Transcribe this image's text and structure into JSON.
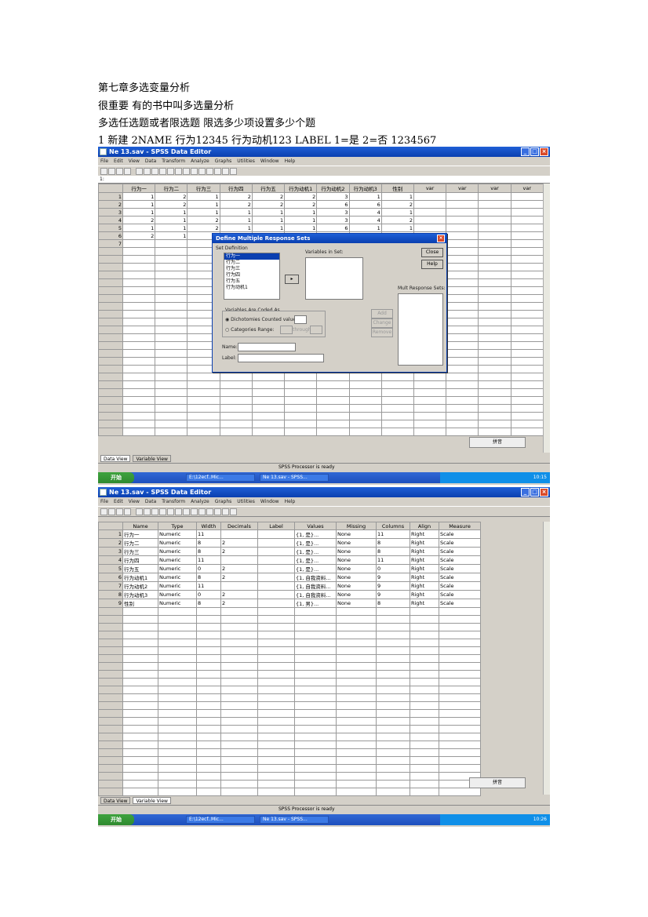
{
  "document": {
    "lines": [
      "第七章多选变量分析",
      "很重要  有的书中叫多选量分析",
      "多选任选题或者限选题  限选多少项设置多少个题",
      "1  新建  2NAME  行为12345  行为动机123 LABEL 1=是  2=否  1234567"
    ]
  },
  "window1": {
    "title": "Ne 13.sav - SPSS Data Editor",
    "menu": [
      "File",
      "Edit",
      "View",
      "Data",
      "Transform",
      "Analyze",
      "Graphs",
      "Utilities",
      "Window",
      "Help"
    ],
    "cell_ref": "1:",
    "columns": [
      "行为一",
      "行为二",
      "行为三",
      "行为四",
      "行为五",
      "行为动机1",
      "行为动机2",
      "行为动机3",
      "性别",
      "var",
      "var",
      "var",
      "var"
    ],
    "rows": [
      {
        "n": "1",
        "v": [
          "1",
          "2",
          "1",
          "2",
          "2",
          "2",
          "3",
          "1",
          "1"
        ]
      },
      {
        "n": "2",
        "v": [
          "1",
          "2",
          "1",
          "2",
          "2",
          "2",
          "6",
          "6",
          "2"
        ]
      },
      {
        "n": "3",
        "v": [
          "1",
          "1",
          "1",
          "1",
          "1",
          "1",
          "3",
          "4",
          "1"
        ]
      },
      {
        "n": "4",
        "v": [
          "2",
          "1",
          "2",
          "1",
          "1",
          "1",
          "3",
          "4",
          "2"
        ]
      },
      {
        "n": "5",
        "v": [
          "1",
          "1",
          "2",
          "1",
          "1",
          "1",
          "6",
          "1",
          "1"
        ]
      },
      {
        "n": "6",
        "v": [
          "2",
          "1",
          "1",
          "2",
          "2",
          "2",
          "5",
          "4",
          "2"
        ]
      },
      {
        "n": "7",
        "v": [
          "",
          "",
          "",
          "",
          "",
          "",
          "",
          "",
          ""
        ]
      }
    ],
    "tabs": [
      "Data View",
      "Variable View"
    ],
    "status": "SPSS Processor is ready",
    "taskbar": {
      "start": "开始",
      "items": [
        "E:\\12ecf..Mic...",
        "Ne 13.sav - SPSS..."
      ],
      "clock": "10:15"
    },
    "ime": "拼音"
  },
  "dialog": {
    "title": "Define Multiple Response Sets",
    "set_definition_label": "Set Definition",
    "variables": [
      "行为一",
      "行为二",
      "行为三",
      "行为四",
      "行为五",
      "行为动机1"
    ],
    "variables_in_set_label": "Variables in Set:",
    "buttons": {
      "close": "Close",
      "help": "Help",
      "add": "Add",
      "change": "Change",
      "remove": "Remove"
    },
    "mult_response_sets_label": "Mult Response Sets:",
    "coded_as_label": "Variables Are Coded As",
    "dichotomies_label": "Dichotomies  Counted value:",
    "categories_label": "Categories  Range:",
    "through_label": "through",
    "name_label": "Name:",
    "label_label": "Label:"
  },
  "window2": {
    "title": "Ne 13.sav - SPSS Data Editor",
    "columns": [
      "Name",
      "Type",
      "Width",
      "Decimals",
      "Label",
      "Values",
      "Missing",
      "Columns",
      "Align",
      "Measure"
    ],
    "rows": [
      {
        "n": "1",
        "v": [
          "行为一",
          "Numeric",
          "11",
          "",
          "",
          "{1, 是}...",
          "None",
          "11",
          "Right",
          "Scale"
        ]
      },
      {
        "n": "2",
        "v": [
          "行为二",
          "Numeric",
          "8",
          "2",
          "",
          "{1, 是}...",
          "None",
          "8",
          "Right",
          "Scale"
        ]
      },
      {
        "n": "3",
        "v": [
          "行为三",
          "Numeric",
          "8",
          "2",
          "",
          "{1, 是}...",
          "None",
          "8",
          "Right",
          "Scale"
        ]
      },
      {
        "n": "4",
        "v": [
          "行为四",
          "Numeric",
          "11",
          "",
          "",
          "{1, 是}...",
          "None",
          "11",
          "Right",
          "Scale"
        ]
      },
      {
        "n": "5",
        "v": [
          "行为五",
          "Numeric",
          "0",
          "2",
          "",
          "{1, 是}...",
          "None",
          "0",
          "Right",
          "Scale"
        ]
      },
      {
        "n": "6",
        "v": [
          "行为动机1",
          "Numeric",
          "8",
          "2",
          "",
          "{1, 自我资料...",
          "None",
          "9",
          "Right",
          "Scale"
        ]
      },
      {
        "n": "7",
        "v": [
          "行为动机2",
          "Numeric",
          "11",
          "",
          "",
          "{1, 自我资料...",
          "None",
          "9",
          "Right",
          "Scale"
        ]
      },
      {
        "n": "8",
        "v": [
          "行为动机3",
          "Numeric",
          "0",
          "2",
          "",
          "{1, 自我资料...",
          "None",
          "9",
          "Right",
          "Scale"
        ]
      },
      {
        "n": "9",
        "v": [
          "性别",
          "Numeric",
          "8",
          "2",
          "",
          "{1, 男}...",
          "None",
          "8",
          "Right",
          "Scale"
        ]
      }
    ],
    "tabs": [
      "Data View",
      "Variable View"
    ],
    "status": "SPSS Processor is ready",
    "taskbar": {
      "start": "开始",
      "items": [
        "E:\\12ecf..Mic...",
        "Ne 13.sav - SPSS..."
      ],
      "clock": "10:26"
    },
    "ime": "拼音"
  }
}
